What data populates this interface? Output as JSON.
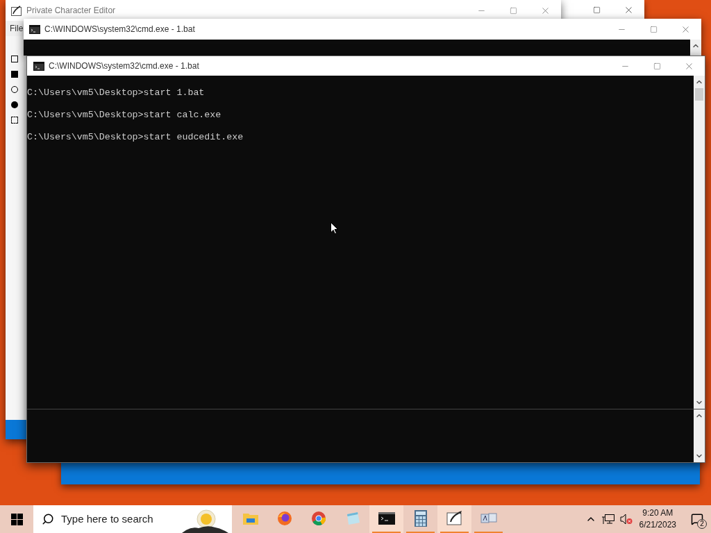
{
  "editor_window": {
    "title": "Private Character Editor",
    "menu": [
      "File"
    ]
  },
  "cmd_back": {
    "title": "C:\\WINDOWS\\system32\\cmd.exe - 1.bat"
  },
  "cmd_front": {
    "title": "C:\\WINDOWS\\system32\\cmd.exe - 1.bat",
    "lines": [
      "C:\\Users\\vm5\\Desktop>start 1.bat",
      "C:\\Users\\vm5\\Desktop>start calc.exe",
      "C:\\Users\\vm5\\Desktop>start eudcedit.exe"
    ]
  },
  "taskbar": {
    "search": {
      "placeholder": "Type here to search"
    },
    "apps": [
      {
        "kind": "folder",
        "running": false,
        "active": false
      },
      {
        "kind": "firefox",
        "running": false,
        "active": false
      },
      {
        "kind": "chrome",
        "running": false,
        "active": false
      },
      {
        "kind": "notepad",
        "running": false,
        "active": false
      },
      {
        "kind": "terminal",
        "running": true,
        "active": true
      },
      {
        "kind": "calculator",
        "running": true,
        "active": false
      },
      {
        "kind": "editor",
        "running": true,
        "active": true
      },
      {
        "kind": "ime",
        "running": true,
        "active": false
      }
    ],
    "time": "9:20 AM",
    "date": "6/21/2023",
    "notifications": "2"
  }
}
